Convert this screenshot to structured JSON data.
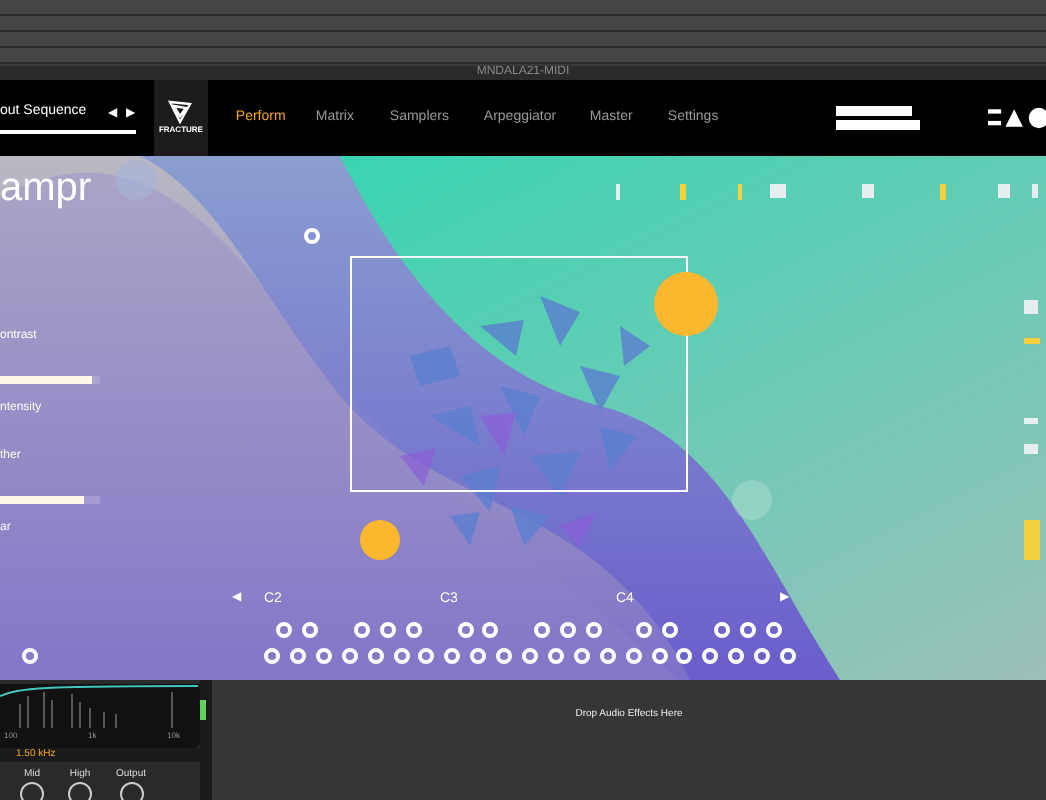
{
  "window": {
    "title": "MNDALA21-MIDI"
  },
  "preset": {
    "name": "out Sequence",
    "prev": "◀",
    "next": "▶"
  },
  "logo": {
    "label": "FRACTURE"
  },
  "tabs": [
    {
      "label": "Perform",
      "selected": true
    },
    {
      "label": "Matrix",
      "selected": false
    },
    {
      "label": "Samplers",
      "selected": false
    },
    {
      "label": "Arpeggiator",
      "selected": false
    },
    {
      "label": "Master",
      "selected": false
    },
    {
      "label": "Settings",
      "selected": false
    }
  ],
  "instrument": {
    "title": "ampr"
  },
  "parameters": [
    {
      "kind": "label",
      "text": "ontrast"
    },
    {
      "kind": "slider",
      "level": 0.92
    },
    {
      "kind": "label",
      "text": "ntensity"
    },
    {
      "kind": "label",
      "text": "ther"
    },
    {
      "kind": "slider",
      "level": 0.84
    },
    {
      "kind": "label",
      "text": "ar"
    }
  ],
  "keyboard": {
    "prev": "◀",
    "next": "▶",
    "octaves": [
      "C2",
      "C3",
      "C4"
    ]
  },
  "device": {
    "freq_labels": [
      "100",
      "1k",
      "10k"
    ],
    "frequency": "1.50 kHz",
    "knobs": [
      "Mid",
      "High",
      "Output"
    ]
  },
  "effects_drop": "Drop Audio Effects Here"
}
